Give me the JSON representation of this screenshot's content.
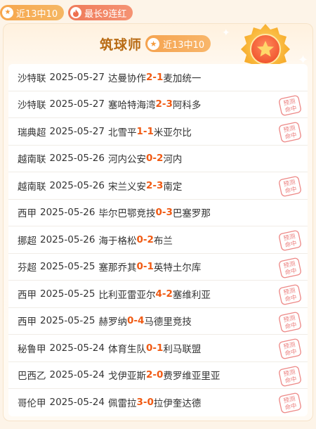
{
  "top_badges": {
    "streak": "近13中10",
    "longest": "最长9连红"
  },
  "header": {
    "title": "筑球师",
    "record": "近13中10"
  },
  "stamp_text": [
    "预测",
    "命中"
  ],
  "matches": [
    {
      "league": "沙特联",
      "date": "2025-05-27",
      "home": "达曼协作",
      "hs": "2",
      "as": "1",
      "away": "麦加统一",
      "hit": false
    },
    {
      "league": "沙特联",
      "date": "2025-05-27",
      "home": "塞哈特海湾",
      "hs": "2",
      "as": "3",
      "away": "阿科多",
      "hit": true
    },
    {
      "league": "瑞典超",
      "date": "2025-05-27",
      "home": "北雪平",
      "hs": "1",
      "as": "1",
      "away": "米亚尔比",
      "hit": true
    },
    {
      "league": "越南联",
      "date": "2025-05-26",
      "home": "河内公安",
      "hs": "0",
      "as": "2",
      "away": "河内",
      "hit": false
    },
    {
      "league": "越南联",
      "date": "2025-05-26",
      "home": "宋兰义安",
      "hs": "2",
      "as": "3",
      "away": "南定",
      "hit": true
    },
    {
      "league": "西甲",
      "date": "2025-05-26",
      "home": "毕尔巴鄂竞技",
      "hs": "0",
      "as": "3",
      "away": "巴塞罗那",
      "hit": false
    },
    {
      "league": "挪超",
      "date": "2025-05-26",
      "home": "海于格松",
      "hs": "0",
      "as": "2",
      "away": "布兰",
      "hit": true
    },
    {
      "league": "芬超",
      "date": "2025-05-25",
      "home": "塞那乔其",
      "hs": "0",
      "as": "1",
      "away": "英特土尔库",
      "hit": true
    },
    {
      "league": "西甲",
      "date": "2025-05-25",
      "home": "比利亚雷亚尔",
      "hs": "4",
      "as": "2",
      "away": "塞维利亚",
      "hit": true
    },
    {
      "league": "西甲",
      "date": "2025-05-25",
      "home": "赫罗纳",
      "hs": "0",
      "as": "4",
      "away": "马德里竞技",
      "hit": true
    },
    {
      "league": "秘鲁甲",
      "date": "2025-05-24",
      "home": "体育生队",
      "hs": "0",
      "as": "1",
      "away": "利马联盟",
      "hit": true
    },
    {
      "league": "巴西乙",
      "date": "2025-05-24",
      "home": "戈伊亚斯",
      "hs": "2",
      "as": "0",
      "away": "费罗维亚里亚",
      "hit": true
    },
    {
      "league": "哥伦甲",
      "date": "2025-05-24",
      "home": "佩雷拉",
      "hs": "3",
      "as": "0",
      "away": "拉伊奎达德",
      "hit": true
    }
  ],
  "colors": {
    "accent": "#f05a13",
    "title": "#b86a12",
    "stamp": "#e86a68"
  }
}
